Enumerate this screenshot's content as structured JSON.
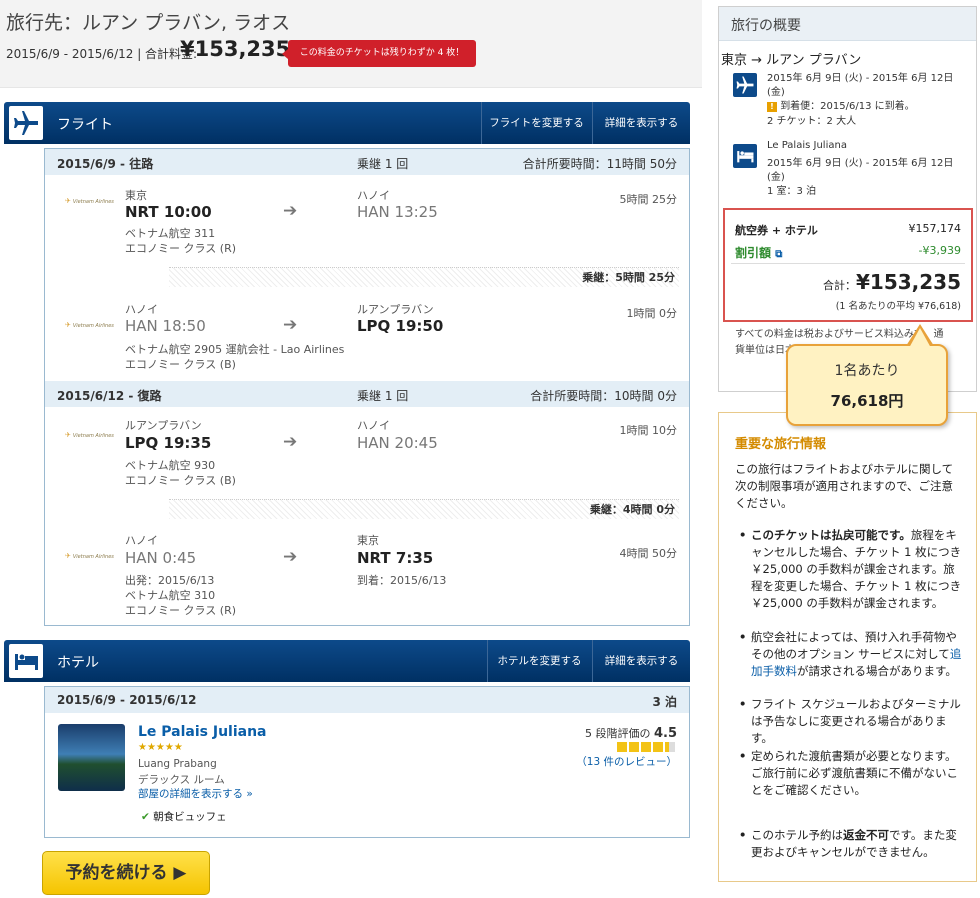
{
  "header": {
    "destination": "旅行先：ルアン プラバン, ラオス",
    "dates_total": "2015/6/9 - 2015/6/12 | 合計料金:",
    "total_price": "¥153,235",
    "alert": "この料金のチケットは残りわずか 4 枚！"
  },
  "flights": {
    "title": "フライト",
    "change_label": "フライトを変更する",
    "details_label": "詳細を表示する",
    "outbound": {
      "date": "2015/6/9 - 往路",
      "stops": "乗継 1 回",
      "total": "合計所要時間：11時間 50分",
      "seg1": {
        "logo": "Vietnam Airlines",
        "from_city": "東京",
        "from_time": "NRT 10:00",
        "to_city": "ハノイ",
        "to_time": "HAN 13:25",
        "duration": "5時間 25分",
        "airline": "ベトナム航空 311",
        "cabin": "エコノミー クラス (R)"
      },
      "layover": "乗継：5時間 25分",
      "seg2": {
        "logo": "Vietnam Airlines",
        "from_city": "ハノイ",
        "from_time": "HAN 18:50",
        "to_city": "ルアンプラバン",
        "to_time": "LPQ 19:50",
        "duration": "1時間 0分",
        "airline": "ベトナム航空 2905 運航会社 - Lao Airlines",
        "cabin": "エコノミー クラス (B)"
      }
    },
    "return": {
      "date": "2015/6/12 - 復路",
      "stops": "乗継 1 回",
      "total": "合計所要時間：10時間 0分",
      "seg1": {
        "logo": "Vietnam Airlines",
        "from_city": "ルアンプラバン",
        "from_time": "LPQ 19:35",
        "to_city": "ハノイ",
        "to_time": "HAN 20:45",
        "duration": "1時間 10分",
        "airline": "ベトナム航空 930",
        "cabin": "エコノミー クラス (B)"
      },
      "layover": "乗継：4時間 0分",
      "seg2": {
        "logo": "Vietnam Airlines",
        "from_city": "ハノイ",
        "from_time": "HAN 0:45",
        "to_city": "東京",
        "to_time": "NRT 7:35",
        "duration": "4時間 50分",
        "depart": "出発：2015/6/13",
        "arrive": "到着：2015/6/13",
        "airline": "ベトナム航空 310",
        "cabin": "エコノミー クラス (R)"
      }
    }
  },
  "hotel": {
    "title": "ホテル",
    "change_label": "ホテルを変更する",
    "details_label": "詳細を表示する",
    "dates": "2015/6/9 - 2015/6/12",
    "nights": "3 泊",
    "name": "Le Palais Juliana",
    "stars": "★★★★★",
    "location": "Luang Prabang",
    "room": "デラックス ルーム",
    "room_details": "部屋の詳細を表示する",
    "rating_label": "5 段階評価の",
    "rating": "4.5",
    "rating_fraction": 0.9,
    "reviews": "（13 件のレビュー）",
    "breakfast": "朝食ビュッフェ"
  },
  "continue_button": "予約を続ける ▶",
  "summary": {
    "title": "旅行の概要",
    "route": "東京 → ルアン プラバン",
    "flight_dates_1": "2015年 6月 9日 (火) - 2015年 6月 12日",
    "flight_dates_2": "(金)",
    "arrival_note": "到着便：2015/6/13 に到着。",
    "tickets": "2 チケット：2 大人",
    "hotel_name": "Le Palais Juliana",
    "hotel_dates_1": "2015年 6月 9日 (火) - 2015年 6月 12日",
    "hotel_dates_2": "(金)",
    "hotel_rooms": "1 室：3 泊",
    "package_label": "航空券 + ホテル",
    "package_price": "¥157,174",
    "discount_label": "割引額",
    "discount": "-¥3,939",
    "total_label": "合計：",
    "total": "¥153,235",
    "per_person": "(1 名あたりの平均 ¥76,618)",
    "note1": "すべての料金は税およびサービス料込みで、通",
    "note2": "貨単位は日本円です。"
  },
  "callout": {
    "line1": "1名あたり",
    "line2": "76,618円"
  },
  "info": {
    "title": "重要な旅行情報",
    "intro": "この旅行はフライトおよびホテルに関して次の制限事項が適用されますので、ご注意ください。",
    "b1_bold": "このチケットは払戻可能です。",
    "b1": "旅程をキャンセルした場合、チケット 1 枚につき ￥25,000 の手数料が課金されます。旅程を変更した場合、チケット 1 枚につき ￥25,000 の手数料が課金されます。",
    "b2a": "航空会社によっては、預け入れ手荷物やその他のオプション サービスに対して",
    "b2_link": "追加手数料",
    "b2b": "が請求される場合があります。",
    "b3": "フライト スケジュールおよびターミナルは予告なしに変更される場合があります。",
    "b4": "定められた渡航書類が必要となります。ご旅行前に必ず渡航書類に不備がないことをご確認ください。",
    "b5a": "このホテル予約は",
    "b5_bold": "返金不可",
    "b5b": "です。また変更およびキャンセルができません。"
  },
  "colors": {
    "navy": "#003063",
    "link": "#0a5ea8",
    "alert": "#d0202a",
    "highlight": "#d9534f",
    "callout_bg": "#fff2c2",
    "discount": "#2e8b2e"
  },
  "icons": [
    "plane-icon",
    "bed-icon",
    "arrow-right-icon",
    "warning-icon",
    "popup-icon",
    "chevron-down-icon",
    "check-icon"
  ]
}
